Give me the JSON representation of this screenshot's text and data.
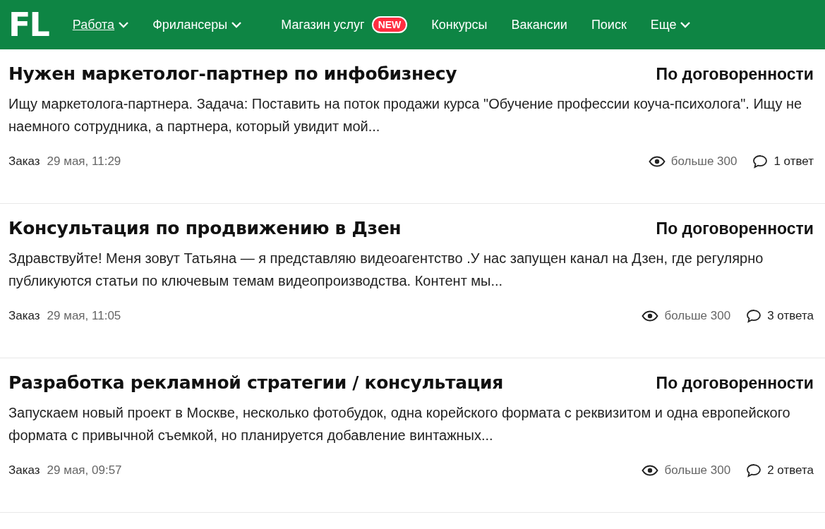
{
  "header": {
    "logo": "FL",
    "nav": [
      {
        "label": "Работа",
        "selected": true,
        "dropdown": true
      },
      {
        "label": "Фрилансеры",
        "selected": false,
        "dropdown": true
      },
      {
        "label": "Магазин услуг",
        "selected": false,
        "dropdown": false,
        "badge": "NEW"
      },
      {
        "label": "Конкурсы",
        "selected": false,
        "dropdown": false
      },
      {
        "label": "Вакансии",
        "selected": false,
        "dropdown": false
      },
      {
        "label": "Поиск",
        "selected": false,
        "dropdown": false
      },
      {
        "label": "Еще",
        "selected": false,
        "dropdown": true
      }
    ]
  },
  "orders": [
    {
      "title": "Нужен маркетолог-партнер по инфобизнесу",
      "price": "По договоренности",
      "description": "Ищу маркетолога-партнера. Задача: Поставить на поток продажи курса \"Обучение профессии коуча-психолога\". Ищу не наемного сотрудника, а партнера, который увидит мой...",
      "type": "Заказ",
      "date": "29 мая, 11:29",
      "views": "больше 300",
      "answers": "1 ответ"
    },
    {
      "title": "Консультация по продвижению в Дзен",
      "price": "По договоренности",
      "description": "Здравствуйте!  Меня зовут Татьяна — я представляю видеоагентство .У нас запущен канал на Дзен, где регулярно публикуются статьи по ключевым темам видеопроизводства. Контент мы...",
      "type": "Заказ",
      "date": "29 мая, 11:05",
      "views": "больше 300",
      "answers": "3 ответа"
    },
    {
      "title": "Разработка рекламной стратегии / консультация",
      "price": "По договоренности",
      "description": "Запускаем новый проект в Москве, несколько фотобудок, одна корейского формата с реквизитом и одна европейского формата с привычной съемкой, но планируется добавление винтажных...",
      "type": "Заказ",
      "date": "29 мая, 09:57",
      "views": "больше 300",
      "answers": "2 ответа"
    }
  ]
}
